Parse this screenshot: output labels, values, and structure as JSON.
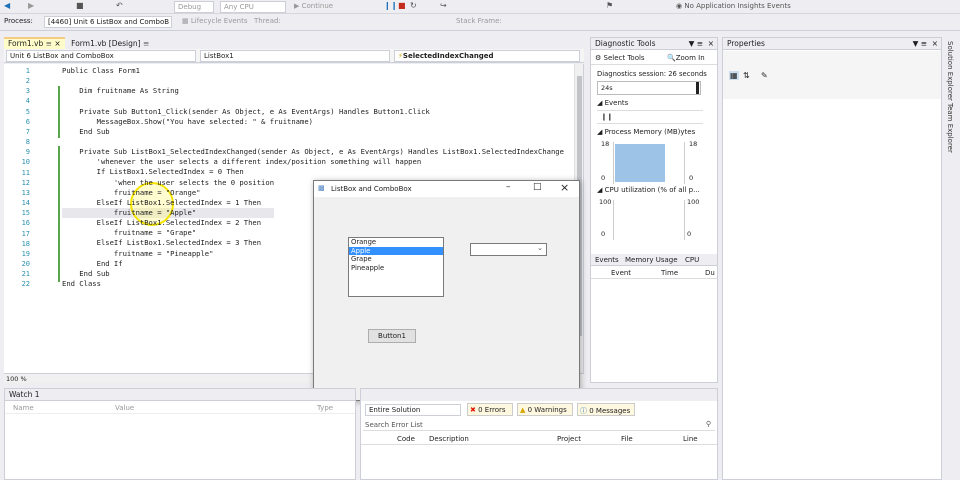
{
  "toolbar": {
    "debug_config": "Debug",
    "cpu": "Any CPU",
    "continue_label": "Continue",
    "app_insights": "No Application Insights Events"
  },
  "process_bar": {
    "process_label": "Process:",
    "process_value": "[4460] Unit 6 ListBox and ComboB",
    "lifecycle": "Lifecycle Events",
    "thread": "Thread:",
    "stack_frame": "Stack Frame:"
  },
  "editor": {
    "tabs": [
      {
        "label": "Form1.vb"
      },
      {
        "label": "Form1.vb [Design]"
      }
    ],
    "nav": {
      "project": "Unit 6 ListBox and ComboBox",
      "object": "ListBox1",
      "event": "SelectedIndexChanged"
    },
    "zoom": "100 %",
    "lines": [
      {
        "n": "1",
        "t": "Public Class Form1"
      },
      {
        "n": "2",
        "t": ""
      },
      {
        "n": "3",
        "t": "    Dim fruitname As String"
      },
      {
        "n": "4",
        "t": ""
      },
      {
        "n": "5",
        "t": "    Private Sub Button1_Click(sender As Object, e As EventArgs) Handles Button1.Click"
      },
      {
        "n": "6",
        "t": "        MessageBox.Show(\"You have selected: \" & fruitname)"
      },
      {
        "n": "7",
        "t": "    End Sub"
      },
      {
        "n": "8",
        "t": ""
      },
      {
        "n": "9",
        "t": "    Private Sub ListBox1_SelectedIndexChanged(sender As Object, e As EventArgs) Handles ListBox1.SelectedIndexChange"
      },
      {
        "n": "10",
        "t": "        'whenever the user selects a different index/position something will happen"
      },
      {
        "n": "11",
        "t": "        If ListBox1.SelectedIndex = 0 Then"
      },
      {
        "n": "12",
        "t": "            'when the user selects the 0 position"
      },
      {
        "n": "13",
        "t": "            fruitname = \"Orange\""
      },
      {
        "n": "14",
        "t": "        ElseIf ListBox1.SelectedIndex = 1 Then"
      },
      {
        "n": "15",
        "t": "            fruitname = \"Apple\""
      },
      {
        "n": "16",
        "t": "        ElseIf ListBox1.SelectedIndex = 2 Then"
      },
      {
        "n": "17",
        "t": "            fruitname = \"Grape\""
      },
      {
        "n": "18",
        "t": "        ElseIf ListBox1.SelectedIndex = 3 Then"
      },
      {
        "n": "19",
        "t": "            fruitname = \"Pineapple\""
      },
      {
        "n": "20",
        "t": "        End If"
      },
      {
        "n": "21",
        "t": "    End Sub"
      },
      {
        "n": "22",
        "t": "End Class"
      }
    ]
  },
  "running_form": {
    "title": "ListBox and ComboBox",
    "listbox_items": [
      "Orange",
      "Apple",
      "Grape",
      "Pineapple"
    ],
    "selected_index": 1,
    "button_label": "Button1"
  },
  "diagnostics": {
    "title": "Diagnostic Tools",
    "select_tools": "Select Tools",
    "zoom_in": "Zoom In",
    "session": "Diagnostics session: 26 seconds",
    "time_tick": "24s",
    "events_label": "Events",
    "memory_label": "Process Memory (MB)",
    "memory_suffix": "ytes",
    "mem_max": "18",
    "mem_min": "0",
    "cpu_label": "CPU utilization (% of all p...",
    "cpu_max": "100",
    "cpu_min": "0",
    "tabs": [
      "Events",
      "Memory Usage",
      "CPU"
    ],
    "cols": [
      "Event",
      "Time",
      "Du"
    ]
  },
  "properties": {
    "title": "Properties"
  },
  "side_tabs": [
    "Solution Explorer",
    "Team Explorer"
  ],
  "watch": {
    "title": "Watch 1",
    "cols": [
      "Name",
      "Value",
      "Type"
    ]
  },
  "error_list": {
    "scope": "Entire Solution",
    "errors": "0 Errors",
    "warnings": "0 Warnings",
    "messages": "0 Messages",
    "search": "Search Error List",
    "cols": [
      "Code",
      "Description",
      "Project",
      "File",
      "Line"
    ]
  }
}
